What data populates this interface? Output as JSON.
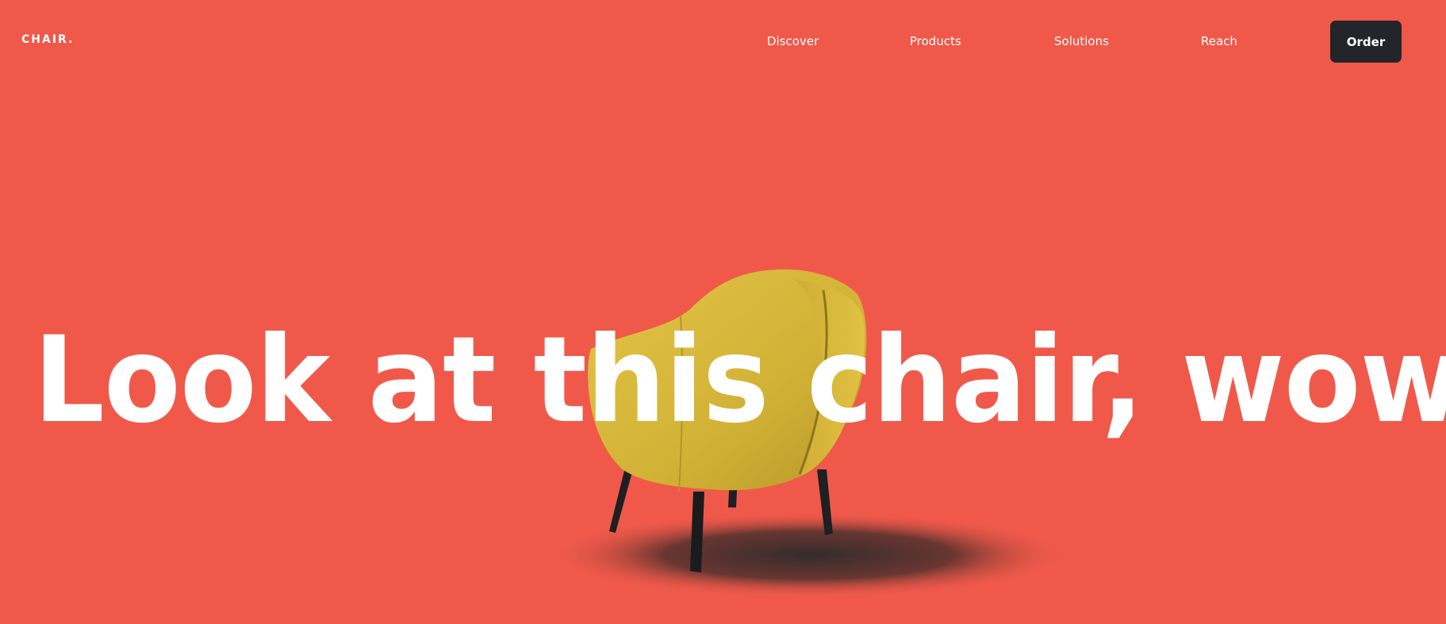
{
  "header": {
    "logo": "CHAIR.",
    "nav": {
      "discover": "Discover",
      "products": "Products",
      "solutions": "Solutions",
      "reach": "Reach"
    },
    "order_label": "Order"
  },
  "hero": {
    "headline": "Look at this chair, wow!"
  },
  "colors": {
    "background": "#f0594a",
    "button": "#23252b",
    "chair": "#d9bb3a",
    "text": "#ffffff"
  },
  "icons": {
    "chair_image": "yellow-armchair-image"
  }
}
